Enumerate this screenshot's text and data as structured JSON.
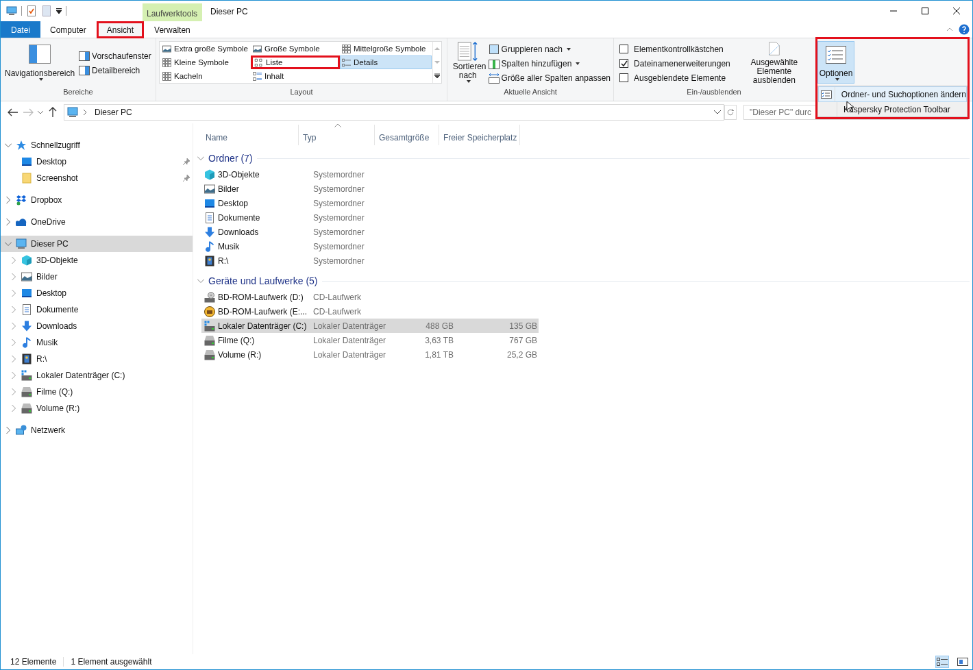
{
  "window": {
    "title": "Dieser PC",
    "context_tab": "Laufwerktools"
  },
  "tabs": [
    {
      "label": "Datei",
      "kind": "file",
      "selected": false,
      "highlighted": false
    },
    {
      "label": "Computer",
      "kind": "tab",
      "selected": false,
      "highlighted": false
    },
    {
      "label": "Ansicht",
      "kind": "tab",
      "selected": true,
      "highlighted": true
    },
    {
      "label": "Verwalten",
      "kind": "tab",
      "selected": false,
      "highlighted": false
    }
  ],
  "ribbon": {
    "panes": {
      "label": "Bereiche",
      "large": "Navigationsbereich",
      "small": [
        "Vorschaufenster",
        "Detailbereich"
      ]
    },
    "layout": {
      "label": "Layout",
      "items": [
        {
          "label": "Extra große Symbole",
          "selected": false,
          "highlighted": false
        },
        {
          "label": "Große Symbole",
          "selected": false,
          "highlighted": false
        },
        {
          "label": "Mittelgroße Symbole",
          "selected": false,
          "highlighted": false
        },
        {
          "label": "Kleine Symbole",
          "selected": false,
          "highlighted": false
        },
        {
          "label": "Liste",
          "selected": false,
          "highlighted": true
        },
        {
          "label": "Details",
          "selected": true,
          "highlighted": false
        },
        {
          "label": "Kacheln",
          "selected": false,
          "highlighted": false
        },
        {
          "label": "Inhalt",
          "selected": false,
          "highlighted": false
        }
      ]
    },
    "current_view": {
      "label": "Aktuelle Ansicht",
      "sort": "Sortieren nach",
      "items": [
        {
          "label": "Gruppieren nach",
          "dropdown": true
        },
        {
          "label": "Spalten hinzufügen",
          "dropdown": true
        },
        {
          "label": "Größe aller Spalten anpassen",
          "dropdown": false
        }
      ]
    },
    "show_hide": {
      "label": "Ein-/ausblenden",
      "checkboxes": [
        {
          "label": "Elementkontrollkästchen",
          "checked": false
        },
        {
          "label": "Dateinamenerweiterungen",
          "checked": true
        },
        {
          "label": "Ausgeblendete Elemente",
          "checked": false
        }
      ],
      "hide_selected": "Ausgewählte Elemente ausblenden"
    },
    "options": {
      "label": "Optionen",
      "expanded": true,
      "highlighted": true,
      "menu": [
        {
          "label": "Ordner- und Suchoptionen ändern",
          "selected": true
        },
        {
          "label": "Kaspersky Protection Toolbar",
          "selected": false
        }
      ]
    }
  },
  "address": {
    "path": [
      "Dieser PC"
    ],
    "search_placeholder": "\"Dieser PC\" durc"
  },
  "nav": [
    {
      "label": "Schnellzugriff",
      "kind": "star",
      "expanded": true,
      "selected": false,
      "children": [
        {
          "label": "Desktop",
          "kind": "desktop",
          "pinned": true,
          "selected": false
        },
        {
          "label": "Screenshot",
          "kind": "folder",
          "pinned": true,
          "selected": false
        }
      ]
    },
    {
      "label": "Dropbox",
      "kind": "dropbox",
      "expanded": false,
      "selected": false
    },
    {
      "label": "OneDrive",
      "kind": "cloud",
      "expanded": false,
      "selected": false
    },
    {
      "label": "Dieser PC",
      "kind": "pc",
      "expanded": true,
      "selected": true,
      "children": [
        {
          "label": "3D-Objekte",
          "kind": "cube",
          "expanded": false,
          "selected": false
        },
        {
          "label": "Bilder",
          "kind": "pictures",
          "expanded": false,
          "selected": false
        },
        {
          "label": "Desktop",
          "kind": "desktop",
          "expanded": false,
          "selected": false
        },
        {
          "label": "Dokumente",
          "kind": "documents",
          "expanded": false,
          "selected": false
        },
        {
          "label": "Downloads",
          "kind": "downloads",
          "expanded": false,
          "selected": false
        },
        {
          "label": "Musik",
          "kind": "music",
          "expanded": false,
          "selected": false
        },
        {
          "label": "R:\\",
          "kind": "film",
          "expanded": false,
          "selected": false
        },
        {
          "label": "Lokaler Datenträger (C:)",
          "kind": "sysdrive",
          "expanded": false,
          "selected": false
        },
        {
          "label": "Filme (Q:)",
          "kind": "drive",
          "expanded": false,
          "selected": false
        },
        {
          "label": "Volume (R:)",
          "kind": "drive",
          "expanded": false,
          "selected": false
        }
      ]
    },
    {
      "label": "Netzwerk",
      "kind": "network",
      "expanded": false,
      "selected": false
    }
  ],
  "columns": [
    {
      "label": "Name",
      "sorted": false
    },
    {
      "label": "Typ",
      "sorted": true
    },
    {
      "label": "Gesamtgröße",
      "sorted": false
    },
    {
      "label": "Freier Speicherplatz",
      "sorted": false
    }
  ],
  "groups": [
    {
      "label": "Ordner (7)",
      "expanded": true,
      "rows": [
        {
          "name": "3D-Objekte",
          "kind": "cube",
          "type": "Systemordner",
          "selected": false
        },
        {
          "name": "Bilder",
          "kind": "pictures",
          "type": "Systemordner",
          "selected": false
        },
        {
          "name": "Desktop",
          "kind": "desktop",
          "type": "Systemordner",
          "selected": false
        },
        {
          "name": "Dokumente",
          "kind": "documents",
          "type": "Systemordner",
          "selected": false
        },
        {
          "name": "Downloads",
          "kind": "downloads",
          "type": "Systemordner",
          "selected": false
        },
        {
          "name": "Musik",
          "kind": "music",
          "type": "Systemordner",
          "selected": false
        },
        {
          "name": "R:\\",
          "kind": "film",
          "type": "Systemordner",
          "selected": false
        }
      ]
    },
    {
      "label": "Geräte und Laufwerke (5)",
      "expanded": true,
      "rows": [
        {
          "name": "BD-ROM-Laufwerk (D:)",
          "kind": "disc",
          "type": "CD-Laufwerk",
          "selected": false
        },
        {
          "name": "BD-ROM-Laufwerk (E:...",
          "kind": "discface",
          "type": "CD-Laufwerk",
          "selected": false
        },
        {
          "name": "Lokaler Datenträger (C:)",
          "kind": "sysdrive",
          "type": "Lokaler Datenträger",
          "total": "488 GB",
          "free": "135 GB",
          "selected": true
        },
        {
          "name": "Filme (Q:)",
          "kind": "drive",
          "type": "Lokaler Datenträger",
          "total": "3,63 TB",
          "free": "767 GB",
          "selected": false
        },
        {
          "name": "Volume (R:)",
          "kind": "drive",
          "type": "Lokaler Datenträger",
          "total": "1,81 TB",
          "free": "25,2 GB",
          "selected": false
        }
      ]
    }
  ],
  "status": {
    "count": "12 Elemente",
    "selection": "1 Element ausgewählt",
    "views": [
      {
        "kind": "details",
        "selected": true
      },
      {
        "kind": "tiles",
        "selected": false
      }
    ]
  }
}
